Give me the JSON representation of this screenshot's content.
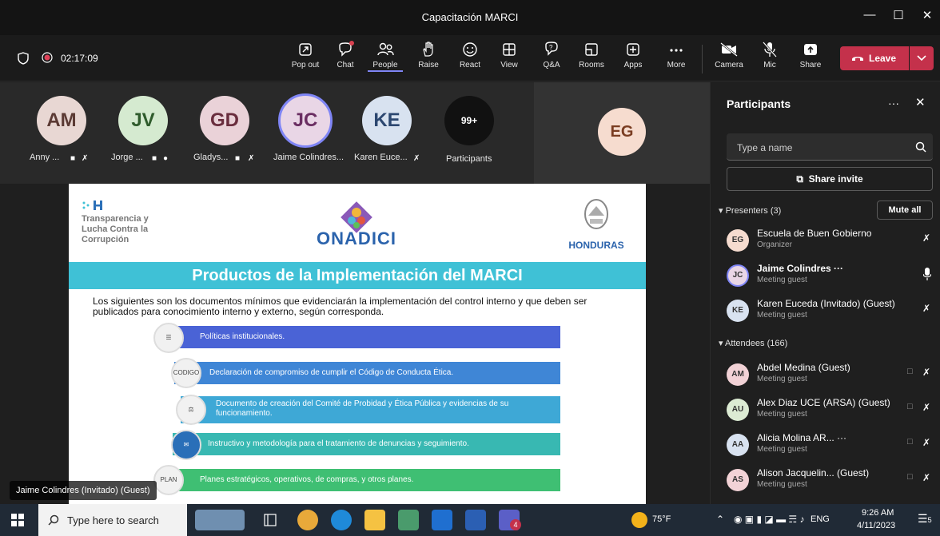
{
  "window": {
    "title": "Capacitación MARCI",
    "controls": [
      "minimize-icon",
      "maximize-icon",
      "close-icon"
    ]
  },
  "toolbar": {
    "timer": "02:17:09",
    "buttons": [
      {
        "label": "Pop out",
        "icon": "pop-out-icon"
      },
      {
        "label": "Chat",
        "icon": "chat-icon"
      },
      {
        "label": "People",
        "icon": "people-icon"
      },
      {
        "label": "Raise",
        "icon": "hand-icon"
      },
      {
        "label": "React",
        "icon": "smile-icon"
      },
      {
        "label": "View",
        "icon": "grid-icon"
      },
      {
        "label": "Q&A",
        "icon": "qa-icon"
      },
      {
        "label": "Rooms",
        "icon": "rooms-icon"
      },
      {
        "label": "Apps",
        "icon": "apps-icon"
      },
      {
        "label": "More",
        "icon": "more-icon"
      },
      {
        "label": "Camera",
        "icon": "camera-off-icon"
      },
      {
        "label": "Mic",
        "icon": "mic-off-icon"
      },
      {
        "label": "Share",
        "icon": "share-icon"
      }
    ],
    "leave_label": "Leave",
    "accent": "#c4314b"
  },
  "gallery": {
    "tiles": [
      {
        "initials": "AM",
        "name": "Anny ...",
        "color": "#e8d7d3"
      },
      {
        "initials": "JV",
        "name": "Jorge ...",
        "color": "#d5ead0"
      },
      {
        "initials": "GD",
        "name": "Gladys...",
        "color": "#ead2d8"
      },
      {
        "initials": "JC",
        "name": "Jaime Colindres...",
        "color": "#e9d6e6"
      },
      {
        "initials": "KE",
        "name": "Karen Euce...",
        "color": "#d8e2f0"
      }
    ],
    "overflow_count": "99+",
    "overflow_label": "Participants",
    "pinned": {
      "initials": "EG",
      "color": "#f6dccf"
    }
  },
  "slide": {
    "org_left": [
      "Transparencia y",
      "Lucha Contra la",
      "Corrupción"
    ],
    "org_center": "ONADICI",
    "org_right": "HONDURAS",
    "title": "Productos de la Implementación del MARCI",
    "intro": "Los siguientes son los documentos mínimos que evidenciarán la implementación del control interno y que deben ser publicados para conocimiento interno y externo, según corresponda.",
    "items": [
      {
        "text": "Políticas institucionales.",
        "color": "#4a63d6"
      },
      {
        "text": "Declaración de compromiso de cumplir el Código de Conducta Ética.",
        "color": "#3f86d6"
      },
      {
        "text": "Documento de creación del Comité de Probidad y Ética Pública y evidencias de su funcionamiento.",
        "color": "#3ea8d6"
      },
      {
        "text": "Instructivo y metodología para el tratamiento de denuncias y seguimiento.",
        "color": "#38b8b2"
      },
      {
        "text": "Planes estratégicos, operativos, de compras, y otros planes.",
        "color": "#3fbf73"
      }
    ]
  },
  "speaker_tag": "Jaime Colindres (Invitado) (Guest)",
  "panel": {
    "title": "Participants",
    "search_placeholder": "Type a name",
    "share_invite": "Share invite",
    "presenters_label": "Presenters (3)",
    "mute_all": "Mute all",
    "presenters": [
      {
        "initials": "EG",
        "name": "Escuela de Buen Gobierno",
        "role": "Organizer",
        "color": "#f6dccf"
      },
      {
        "initials": "JC",
        "name": "Jaime Colindres ···",
        "role": "Meeting guest",
        "color": "#e9d6e6"
      },
      {
        "initials": "KE",
        "name": "Karen Euceda (Invitado) (Guest)",
        "role": "Meeting guest",
        "color": "#d8e2f0"
      }
    ],
    "attendees_label": "Attendees (166)",
    "attendees": [
      {
        "initials": "AM",
        "name": "Abdel Medina (Guest)",
        "role": "Meeting guest",
        "color": "#f2d2d6"
      },
      {
        "initials": "AU",
        "name": "Alex Diaz UCE (ARSA) (Guest)",
        "role": "Meeting guest",
        "color": "#dcebd3"
      },
      {
        "initials": "AA",
        "name": "Alicia Molina AR... ···",
        "role": "Meeting guest",
        "color": "#d8e2f0"
      },
      {
        "initials": "AS",
        "name": "Alison Jacquelin... (Guest)",
        "role": "Meeting guest",
        "color": "#f2d2d6"
      }
    ]
  },
  "taskbar": {
    "search_placeholder": "Type here to search",
    "weather": "75°F",
    "lang": "ENG",
    "time": "9:26 AM",
    "date": "4/11/2023",
    "notif_count": "5",
    "teams_badge": "4"
  }
}
